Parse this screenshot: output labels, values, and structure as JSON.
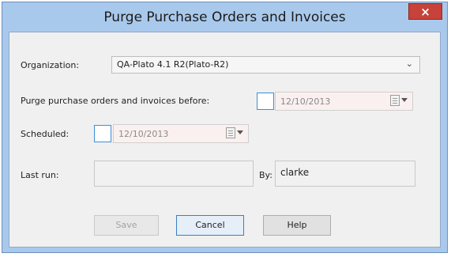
{
  "window": {
    "title": "Purge Purchase Orders and Invoices",
    "close_glyph": "×"
  },
  "organization": {
    "label": "Organization:",
    "value": "QA-Plato 4.1 R2(Plato-R2)",
    "dropdown_icon": "chevron-down-icon"
  },
  "purge_before": {
    "label": "Purge purchase orders and invoices before:",
    "date": "12/10/2013",
    "checked": false
  },
  "scheduled": {
    "label": "Scheduled:",
    "date": "12/10/2013",
    "checked": false
  },
  "last_run": {
    "label": "Last run:",
    "value": ""
  },
  "by": {
    "label": "By:",
    "value": "clarke"
  },
  "buttons": {
    "save": "Save",
    "cancel": "Cancel",
    "help": "Help"
  },
  "colors": {
    "frame": "#a9c9ec",
    "close": "#c6423a",
    "focus_border": "#3c8fd9",
    "date_field_bg": "#fbf0f0"
  }
}
